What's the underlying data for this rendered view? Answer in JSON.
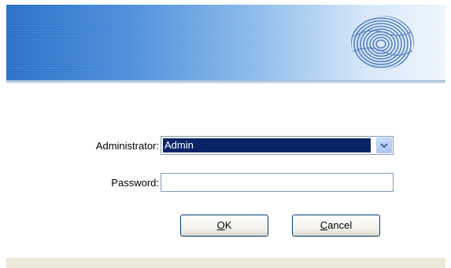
{
  "banner": {
    "icon": "fingerprint-icon",
    "colors": {
      "start": "#2a6fc8",
      "end": "#eef5fd"
    }
  },
  "form": {
    "administrator_label": "Administrator:",
    "administrator_value": "Admin",
    "administrator_options": [
      "Admin"
    ],
    "password_label": "Password:",
    "password_value": "",
    "password_placeholder": ""
  },
  "buttons": {
    "ok": {
      "mnemonic": "O",
      "rest": "K"
    },
    "cancel": {
      "mnemonic": "C",
      "rest": "ancel"
    }
  },
  "colors": {
    "selection": "#0a246a",
    "field_border": "#7f9db9",
    "button_border": "#003c74",
    "dialog_face": "#ece9d8"
  }
}
